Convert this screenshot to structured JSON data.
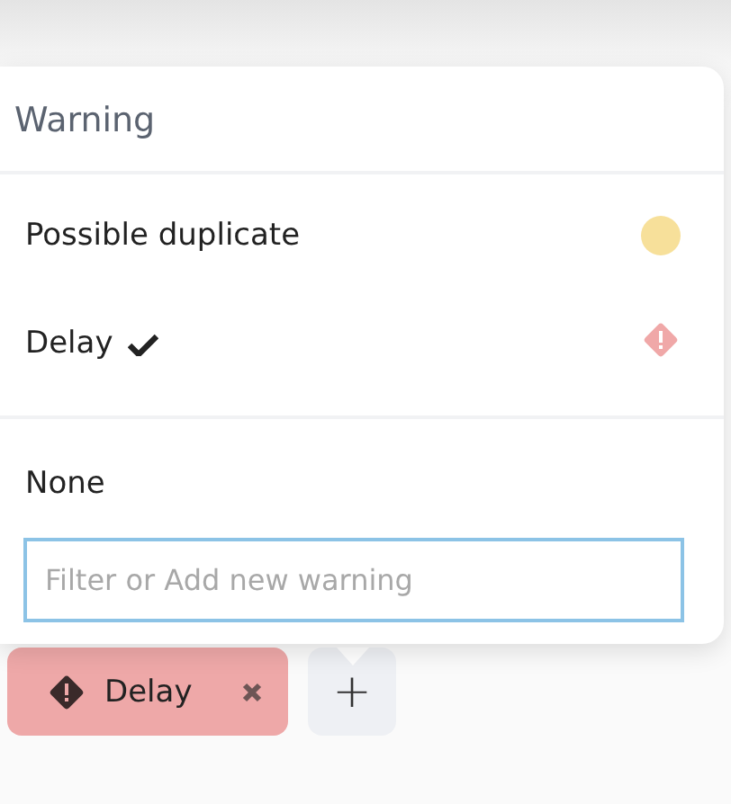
{
  "dropdown": {
    "title": "Warning",
    "items": [
      {
        "label": "Possible duplicate",
        "kind": "dot",
        "color": "#f7e09a",
        "selected": false
      },
      {
        "label": "Delay",
        "kind": "diamond",
        "color": "#f0a8a8",
        "selected": true
      }
    ],
    "none_option": {
      "label": "None",
      "selected": false
    },
    "filter": {
      "placeholder": "Filter or Add new warning"
    }
  },
  "tags": [
    {
      "label": "Delay",
      "color": "#eea8a8"
    }
  ],
  "add_button": {
    "label": "+"
  }
}
